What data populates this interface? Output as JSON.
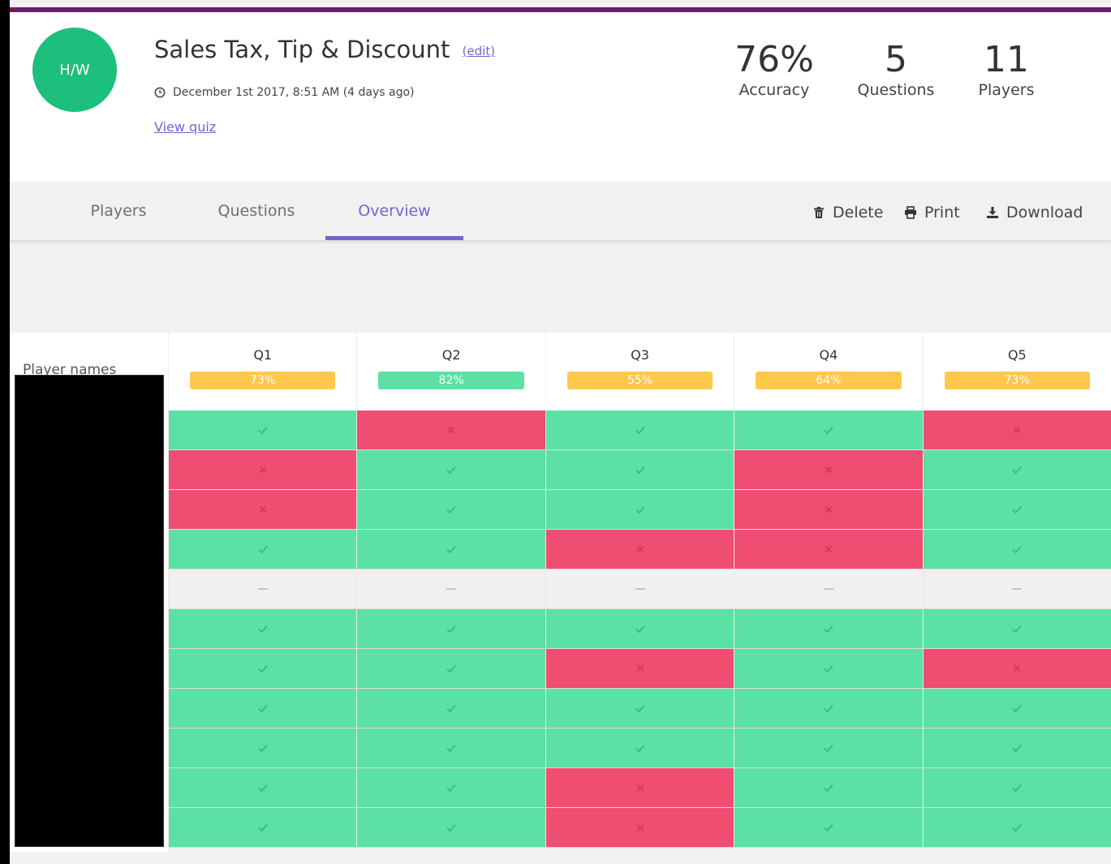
{
  "quiz": {
    "avatar_text": "H/W",
    "title": "Sales Tax, Tip & Discount",
    "edit_label": "(edit)",
    "date": "December 1st 2017, 8:51 AM (4 days ago)",
    "view_quiz_label": "View quiz"
  },
  "stats": {
    "accuracy": {
      "value": "76%",
      "label": "Accuracy"
    },
    "questions": {
      "value": "5",
      "label": "Questions"
    },
    "players": {
      "value": "11",
      "label": "Players"
    }
  },
  "tabs": [
    {
      "label": "Players",
      "active": false
    },
    {
      "label": "Questions",
      "active": false
    },
    {
      "label": "Overview",
      "active": true
    }
  ],
  "actions": {
    "delete": {
      "label": "Delete",
      "icon": "trash-icon"
    },
    "print": {
      "label": "Print",
      "icon": "printer-icon"
    },
    "download": {
      "label": "Download",
      "icon": "download-icon"
    }
  },
  "overview": {
    "names_header": "Player names",
    "questions": [
      {
        "label": "Q1",
        "accuracy": "73%",
        "color": "#fec84b"
      },
      {
        "label": "Q2",
        "accuracy": "82%",
        "color": "#5ce1a4"
      },
      {
        "label": "Q3",
        "accuracy": "55%",
        "color": "#fec84b"
      },
      {
        "label": "Q4",
        "accuracy": "64%",
        "color": "#fec84b"
      },
      {
        "label": "Q5",
        "accuracy": "73%",
        "color": "#fec84b"
      }
    ],
    "results": [
      [
        "correct",
        "wrong",
        "correct",
        "correct",
        "wrong"
      ],
      [
        "wrong",
        "correct",
        "correct",
        "wrong",
        "correct"
      ],
      [
        "wrong",
        "correct",
        "correct",
        "wrong",
        "correct"
      ],
      [
        "correct",
        "correct",
        "wrong",
        "wrong",
        "correct"
      ],
      [
        "none",
        "none",
        "none",
        "none",
        "none"
      ],
      [
        "correct",
        "correct",
        "correct",
        "correct",
        "correct"
      ],
      [
        "correct",
        "correct",
        "wrong",
        "correct",
        "wrong"
      ],
      [
        "correct",
        "correct",
        "correct",
        "correct",
        "correct"
      ],
      [
        "correct",
        "correct",
        "correct",
        "correct",
        "correct"
      ],
      [
        "correct",
        "correct",
        "wrong",
        "correct",
        "correct"
      ],
      [
        "correct",
        "correct",
        "wrong",
        "correct",
        "correct"
      ]
    ]
  },
  "colors": {
    "correct": "#5ce1a4",
    "wrong": "#f04d72",
    "unanswered": "#f0f0f0",
    "accent": "#7a5fd1",
    "avatar": "#1dbf7c",
    "topbar": "#6b1e63"
  }
}
